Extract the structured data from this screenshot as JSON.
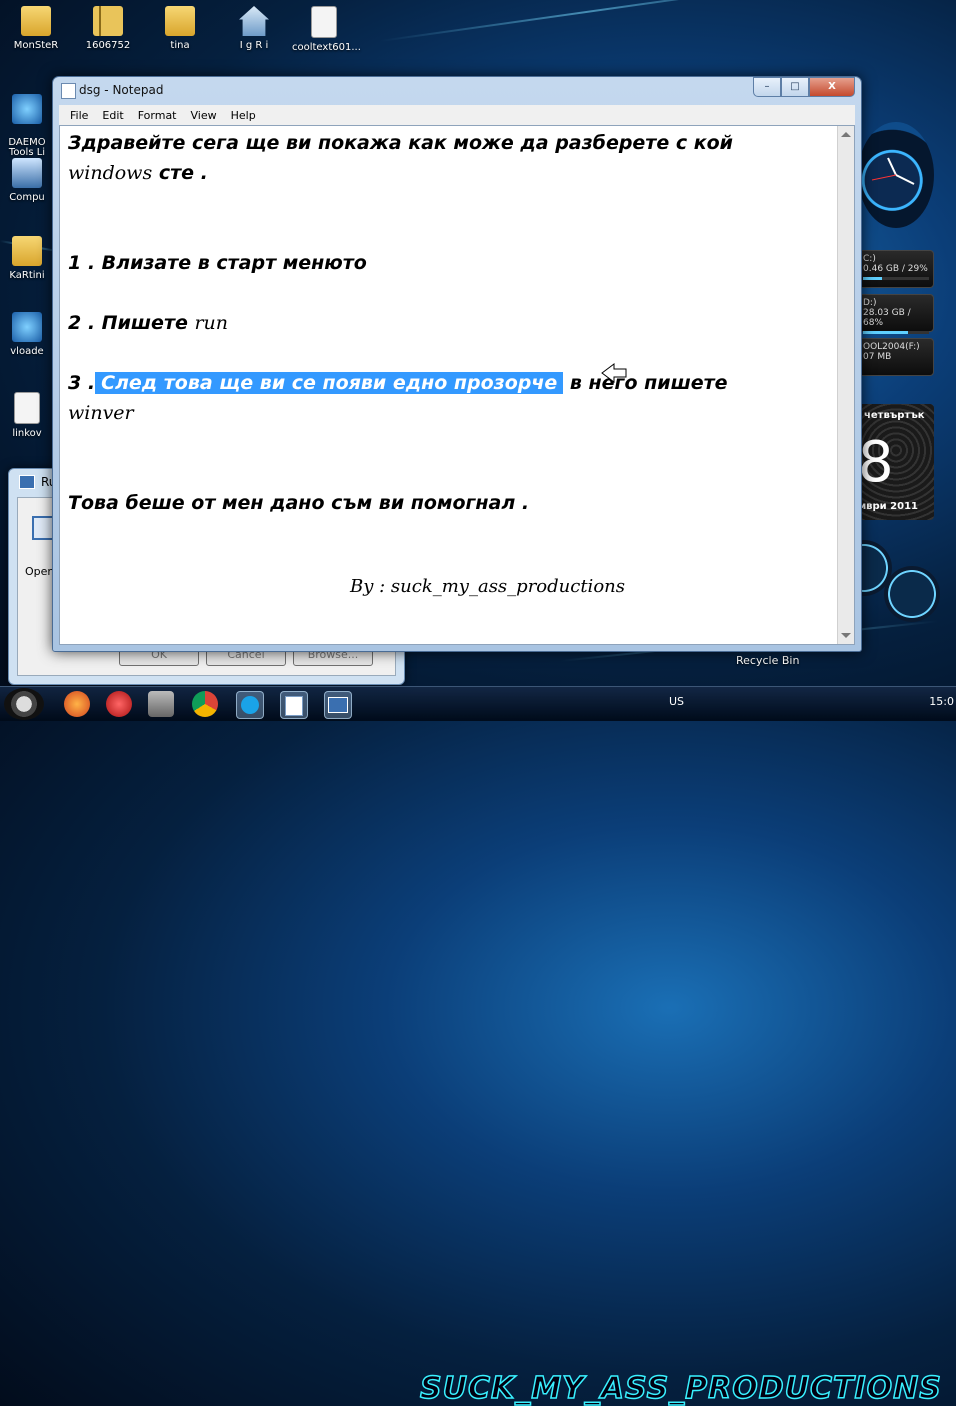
{
  "desktop": {
    "icons": [
      {
        "label": "MonSteR",
        "icon": "folder-icon"
      },
      {
        "label": "1606752",
        "icon": "zip-icon"
      },
      {
        "label": "tina",
        "icon": "folder-icon"
      },
      {
        "label": "I g R i",
        "icon": "home-icon"
      },
      {
        "label": "cooltext601...",
        "icon": "document-icon"
      }
    ],
    "left_icons": [
      {
        "label": "DAEMO\nTools Li",
        "icon": "daemon-tools-icon"
      },
      {
        "label": "Compu",
        "icon": "computer-icon"
      },
      {
        "label": "KaRtini",
        "icon": "badge-icon"
      },
      {
        "label": "vloade",
        "icon": "gear-icon"
      },
      {
        "label": "linkov",
        "icon": "document-icon"
      }
    ],
    "recycle_bin_label": "Recycle Bin"
  },
  "run_dialog": {
    "title": "Ru",
    "open_label": "Open",
    "buttons": [
      "OK",
      "Cancel",
      "Browse..."
    ]
  },
  "notepad": {
    "title": "dsg - Notepad",
    "menu": [
      "File",
      "Edit",
      "Format",
      "View",
      "Help"
    ],
    "lines": {
      "l1": "Здравейте сега ще ви покажа как може да разберете с кой",
      "l2_script": "windows",
      "l2_rest": " сте .",
      "l3": "1 . Влизате в старт менюто",
      "l4_prefix": "2 . Пишете ",
      "l4_script": "run",
      "l5_prefix": "3 .",
      "l5_selected": "След това ще ви се появи едно прозорче",
      "l5_rest": " в него пишете",
      "l6_script": "winver",
      "l7": "Това беше от мен дано съм ви помогнал .",
      "signature": "By : suck_my_ass_productions"
    },
    "window_buttons": {
      "minimize": "–",
      "maximize": "□",
      "close": "X"
    }
  },
  "gadgets": {
    "drives": [
      {
        "name": "C:)",
        "info": "0.46 GB / 29%",
        "fill": 0.29
      },
      {
        "name": "D:)",
        "info": "28.03 GB / 68%",
        "fill": 0.68
      },
      {
        "name": "OOL2004(F:)",
        "info": "07 MB",
        "fill": 0.1
      }
    ],
    "calendar": {
      "day": "четвъртък",
      "date": "8",
      "month": "мври 2011"
    }
  },
  "taskbar": {
    "lang": "US",
    "time": "15:0",
    "brand_text": "SUCK_MY_ASS_PRODUCTIONS"
  }
}
